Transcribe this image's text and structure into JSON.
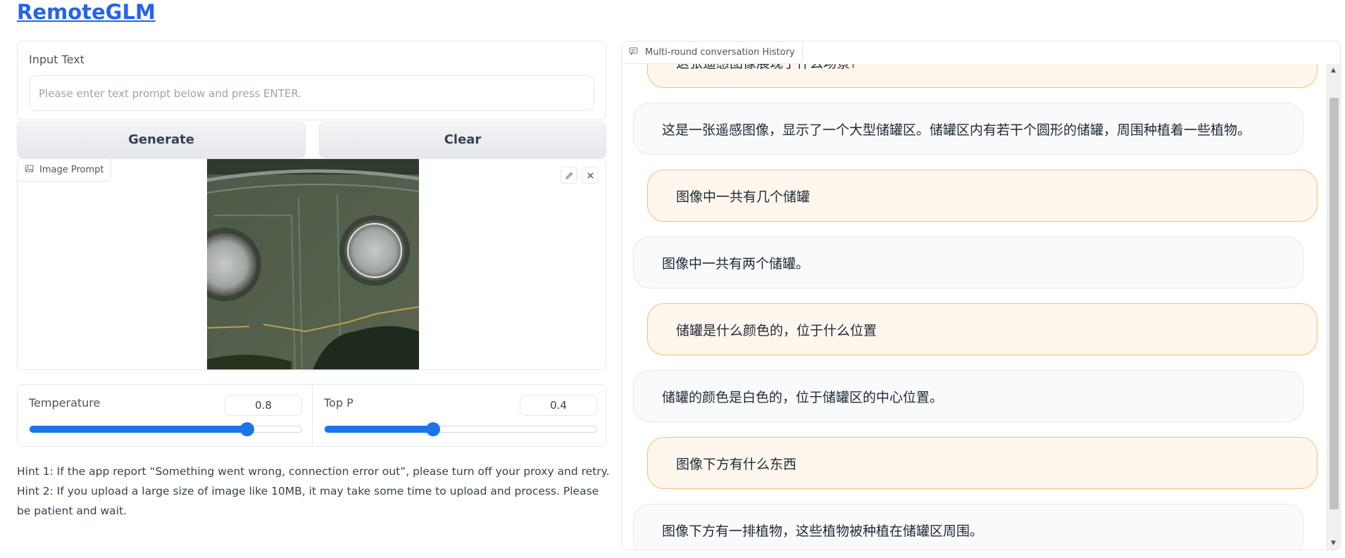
{
  "app": {
    "title": "RemoteGLM"
  },
  "input": {
    "label": "Input Text",
    "placeholder": "Please enter text prompt below and press ENTER.",
    "value": ""
  },
  "buttons": {
    "generate": "Generate",
    "clear": "Clear"
  },
  "image_prompt": {
    "label": "Image Prompt",
    "icon": "image-icon",
    "actions": [
      "pencil-icon",
      "close-icon"
    ]
  },
  "sliders": {
    "temperature": {
      "label": "Temperature",
      "value": "0.8",
      "fraction": 0.8
    },
    "top_p": {
      "label": "Top P",
      "value": "0.4",
      "fraction": 0.4
    }
  },
  "hints": {
    "hint1": "Hint 1: If the app report “Something went wrong, connection error out”, please turn off your proxy and retry.",
    "hint2": "Hint 2: If you upload a large size of image like 10MB, it may take some time to upload and process. Please be patient and wait."
  },
  "chat": {
    "label": "Multi-round conversation History",
    "messages": [
      {
        "role": "user",
        "text": "这张遥感图像展现了什么场景?"
      },
      {
        "role": "bot",
        "text": "这是一张遥感图像，显示了一个大型储罐区。储罐区内有若干个圆形的储罐，周围种植着一些植物。"
      },
      {
        "role": "user",
        "text": "图像中一共有几个储罐"
      },
      {
        "role": "bot",
        "text": "图像中一共有两个储罐。"
      },
      {
        "role": "user",
        "text": "储罐是什么颜色的，位于什么位置"
      },
      {
        "role": "bot",
        "text": "储罐的颜色是白色的，位于储罐区的中心位置。"
      },
      {
        "role": "user",
        "text": "图像下方有什么东西"
      },
      {
        "role": "bot",
        "text": "图像下方有一排植物，这些植物被种植在储罐区周围。"
      }
    ]
  },
  "colors": {
    "accent": "#1b74e8",
    "link": "#2563eb",
    "user_bubble": "#fff7ed",
    "user_border": "#fdba74",
    "bot_bubble": "#f9fafb"
  }
}
